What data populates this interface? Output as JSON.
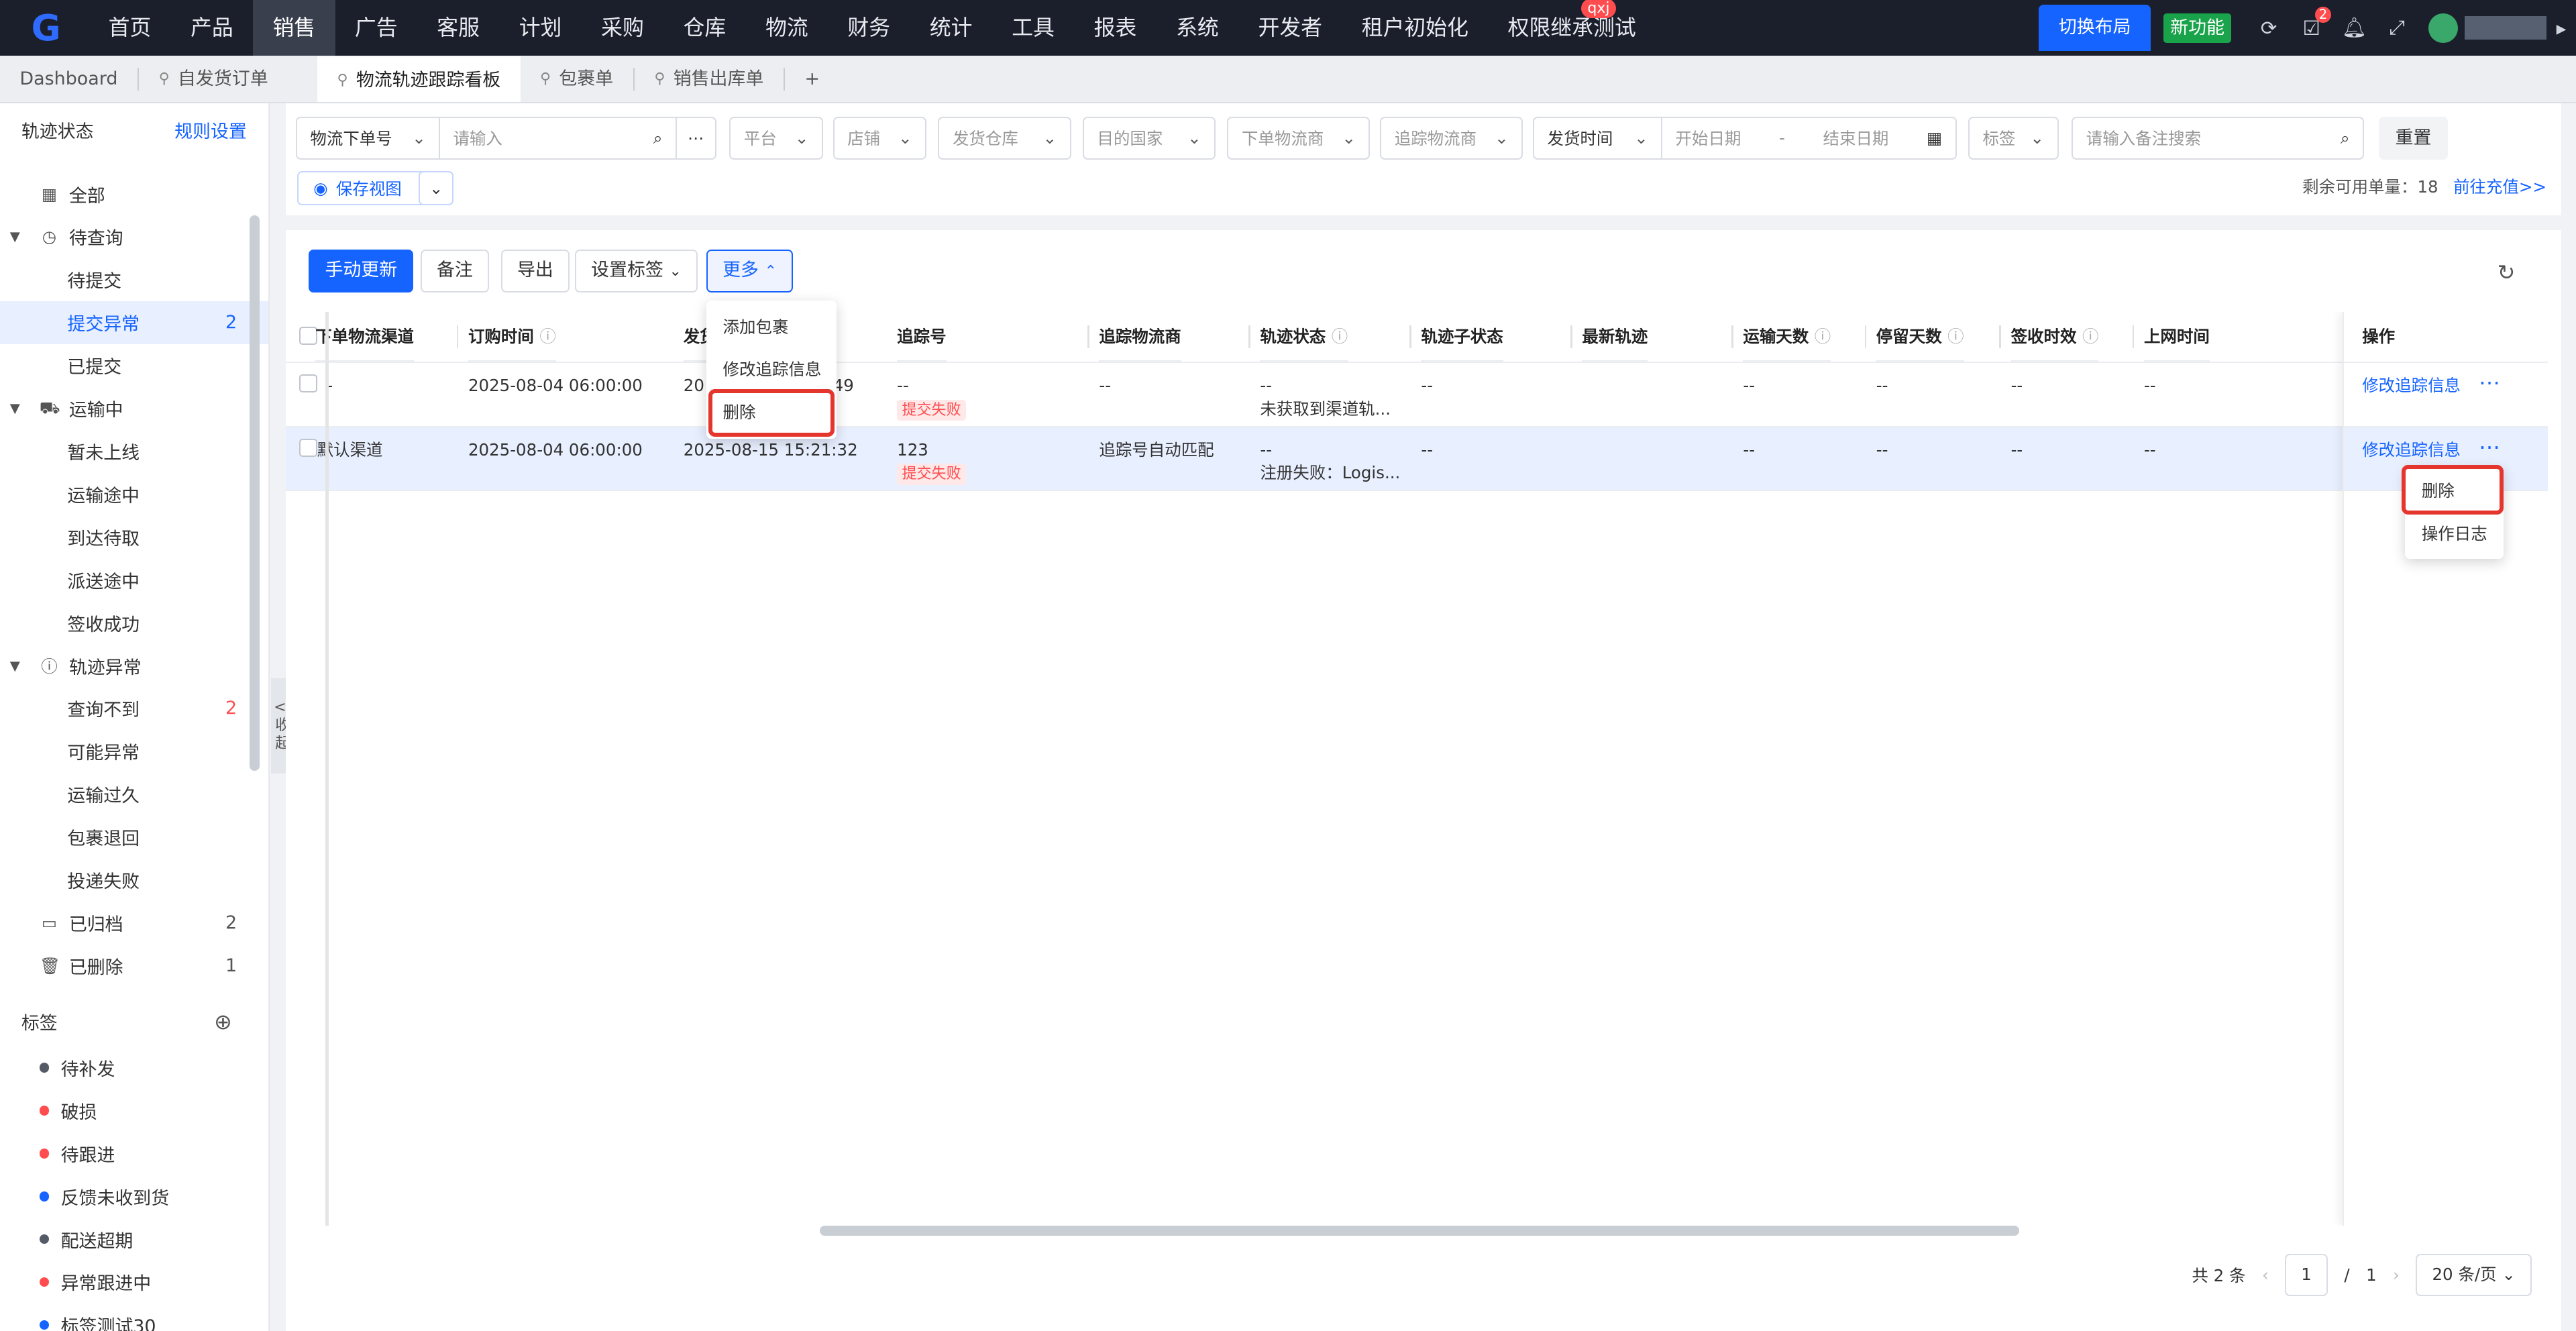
{
  "nav": {
    "logo": "G",
    "menu": [
      "首页",
      "产品",
      "销售",
      "广告",
      "客服",
      "计划",
      "采购",
      "仓库",
      "物流",
      "财务",
      "统计",
      "工具",
      "报表",
      "系统",
      "开发者",
      "租户初始化",
      "权限继承测试"
    ],
    "active_index": 2,
    "qxj_badge": "qxj",
    "switch_layout": "切换布局",
    "new_feature": "新功能",
    "task_count": "2"
  },
  "tabs": [
    {
      "label": "Dashboard"
    },
    {
      "label": "自发货订单"
    },
    {
      "label": "物流轨迹跟踪看板"
    },
    {
      "label": "包裹单"
    },
    {
      "label": "销售出库单"
    },
    {
      "label": "+"
    }
  ],
  "sidebar": {
    "title": "轨迹状态",
    "rules": "规则设置",
    "items": [
      {
        "label": "全部",
        "icon": "grid-icon",
        "level": 1,
        "count": ""
      },
      {
        "label": "待查询",
        "icon": "clock-icon",
        "level": 1,
        "count": "",
        "caret": true
      },
      {
        "label": "待提交",
        "level": 2,
        "count": ""
      },
      {
        "label": "提交异常",
        "level": 2,
        "count": "2",
        "selected": true
      },
      {
        "label": "已提交",
        "level": 2,
        "count": ""
      },
      {
        "label": "运输中",
        "icon": "truck-icon",
        "level": 1,
        "count": "",
        "caret": true
      },
      {
        "label": "暂未上线",
        "level": 2,
        "count": ""
      },
      {
        "label": "运输途中",
        "level": 2,
        "count": ""
      },
      {
        "label": "到达待取",
        "level": 2,
        "count": ""
      },
      {
        "label": "派送途中",
        "level": 2,
        "count": ""
      },
      {
        "label": "签收成功",
        "level": 2,
        "count": ""
      },
      {
        "label": "轨迹异常",
        "icon": "alert-icon",
        "level": 1,
        "count": "",
        "caret": true
      },
      {
        "label": "查询不到",
        "level": 2,
        "count": "2",
        "red": true
      },
      {
        "label": "可能异常",
        "level": 2,
        "count": ""
      },
      {
        "label": "运输过久",
        "level": 2,
        "count": ""
      },
      {
        "label": "包裹退回",
        "level": 2,
        "count": ""
      },
      {
        "label": "投递失败",
        "level": 2,
        "count": ""
      },
      {
        "label": "已归档",
        "icon": "archive-icon",
        "level": 1,
        "count": "2"
      },
      {
        "label": "已删除",
        "icon": "trash-icon",
        "level": 1,
        "count": "1"
      }
    ],
    "tags_title": "标签",
    "tags": [
      {
        "label": "待补发",
        "color": "#555b66"
      },
      {
        "label": "破损",
        "color": "#ff4d4f"
      },
      {
        "label": "待跟进",
        "color": "#ff4d4f"
      },
      {
        "label": "反馈未收到货",
        "color": "#1664ff"
      },
      {
        "label": "配送超期",
        "color": "#555b66"
      },
      {
        "label": "异常跟进中",
        "color": "#ff4d4f"
      },
      {
        "label": "标签测试30",
        "color": "#1664ff"
      }
    ],
    "collapse": [
      "<|",
      "收",
      "起"
    ]
  },
  "filters": {
    "order_type": "物流下单号",
    "input_placeholder": "请输入",
    "platform": "平台",
    "store": "店铺",
    "warehouse": "发货仓库",
    "country": "目的国家",
    "logistics": "下单物流商",
    "tracker": "追踪物流商",
    "time_type": "发货时间",
    "start_date": "开始日期",
    "date_sep": "-",
    "end_date": "结束日期",
    "tag": "标签",
    "remark_placeholder": "请输入备注搜索",
    "reset": "重置",
    "save_view": "保存视图",
    "quota_label": "剩余可用单量：",
    "quota_value": "18",
    "recharge": "前往充值>>"
  },
  "toolbar": {
    "manual_update": "手动更新",
    "remark": "备注",
    "export": "导出",
    "set_tag": "设置标签",
    "more": "更多"
  },
  "table": {
    "headers": [
      "下单物流渠道",
      "订购时间",
      "发货",
      "追踪号",
      "追踪物流商",
      "轨迹状态",
      "轨迹子状态",
      "最新轨迹",
      "运输天数",
      "停留天数",
      "签收时效",
      "上网时间",
      "操作"
    ],
    "rows": [
      {
        "channel": "-",
        "order_time": "2025-08-04 06:00:00",
        "ship_time": "20",
        "ship_time_tail": "49",
        "tracking_no": "--",
        "fail": "提交失败",
        "tracker": "--",
        "status": "--",
        "status_detail": "未获取到渠道轨...",
        "sub_status": "--",
        "latest": "",
        "days": "--",
        "stay": "--",
        "sign": "--",
        "online": "--",
        "action": "修改追踪信息"
      },
      {
        "channel": "默认渠道",
        "order_time": "2025-08-04 06:00:00",
        "ship_time": "2025-08-15 15:21:32",
        "ship_time_tail": "",
        "tracking_no": "123",
        "fail": "提交失败",
        "tracker": "追踪号自动匹配",
        "status": "--",
        "status_detail": "注册失败：Logis...",
        "sub_status": "--",
        "latest": "",
        "days": "--",
        "stay": "--",
        "sign": "--",
        "online": "--",
        "action": "修改追踪信息"
      }
    ]
  },
  "more_menu": [
    "添加包裹",
    "修改追踪信息",
    "删除"
  ],
  "row_menu": [
    "删除",
    "操作日志"
  ],
  "pager": {
    "total": "共 2 条",
    "page": "1",
    "sep": "/",
    "pages": "1",
    "size": "20 条/页"
  },
  "colors": {
    "primary": "#1664ff",
    "danger": "#ff4d4f",
    "nav_bg": "#1b1f2b",
    "highlight": "#e5362e"
  }
}
